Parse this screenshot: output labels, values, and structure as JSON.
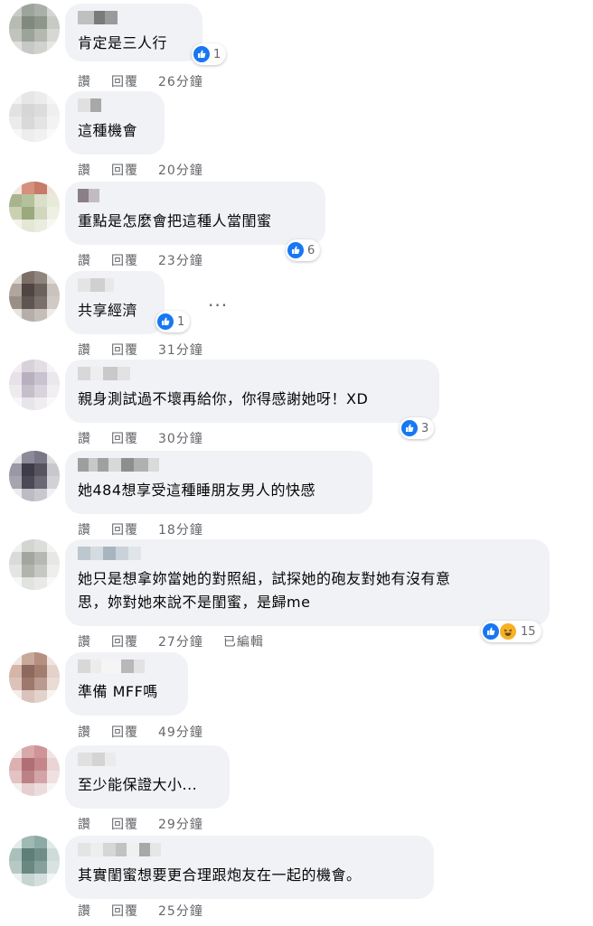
{
  "colors": {
    "bubble": "#f0f2f5",
    "meta_text": "#65676b",
    "like_blue": "#1877f2",
    "haha_yellow": "#f7b125"
  },
  "actions": {
    "like": "讚",
    "reply": "回覆",
    "edited": "已編輯"
  },
  "more_menu": "···",
  "comments": [
    {
      "text": "肯定是三人行",
      "time": "26分鐘",
      "reaction_count": "1",
      "reaction_types": [
        "like"
      ]
    },
    {
      "text": "這種機會",
      "time": "20分鐘"
    },
    {
      "text": "重點是怎麼會把這種人當閨蜜",
      "time": "23分鐘",
      "reaction_count": "6",
      "reaction_types": [
        "like"
      ]
    },
    {
      "text": "共享經濟",
      "time": "31分鐘",
      "reaction_count": "1",
      "reaction_types": [
        "like"
      ]
    },
    {
      "text": "親身測試過不壞再給你，你得感謝她呀！XD",
      "time": "30分鐘",
      "reaction_count": "3",
      "reaction_types": [
        "like"
      ]
    },
    {
      "text": "她484想享受這種睡朋友男人的快感",
      "time": "18分鐘"
    },
    {
      "text": "她只是想拿妳當她的對照組，試探她的砲友對她有沒有意\n思，妳對她來說不是閨蜜，是歸me",
      "time": "27分鐘",
      "reaction_count": "15",
      "reaction_types": [
        "like",
        "haha"
      ]
    },
    {
      "text": "準備 MFF嗎",
      "time": "49分鐘"
    },
    {
      "text": "至少能保證大小...",
      "time": "29分鐘"
    },
    {
      "text": "其實閨蜜想要更合理跟炮友在一起的機會。",
      "time": "25分鐘"
    }
  ]
}
